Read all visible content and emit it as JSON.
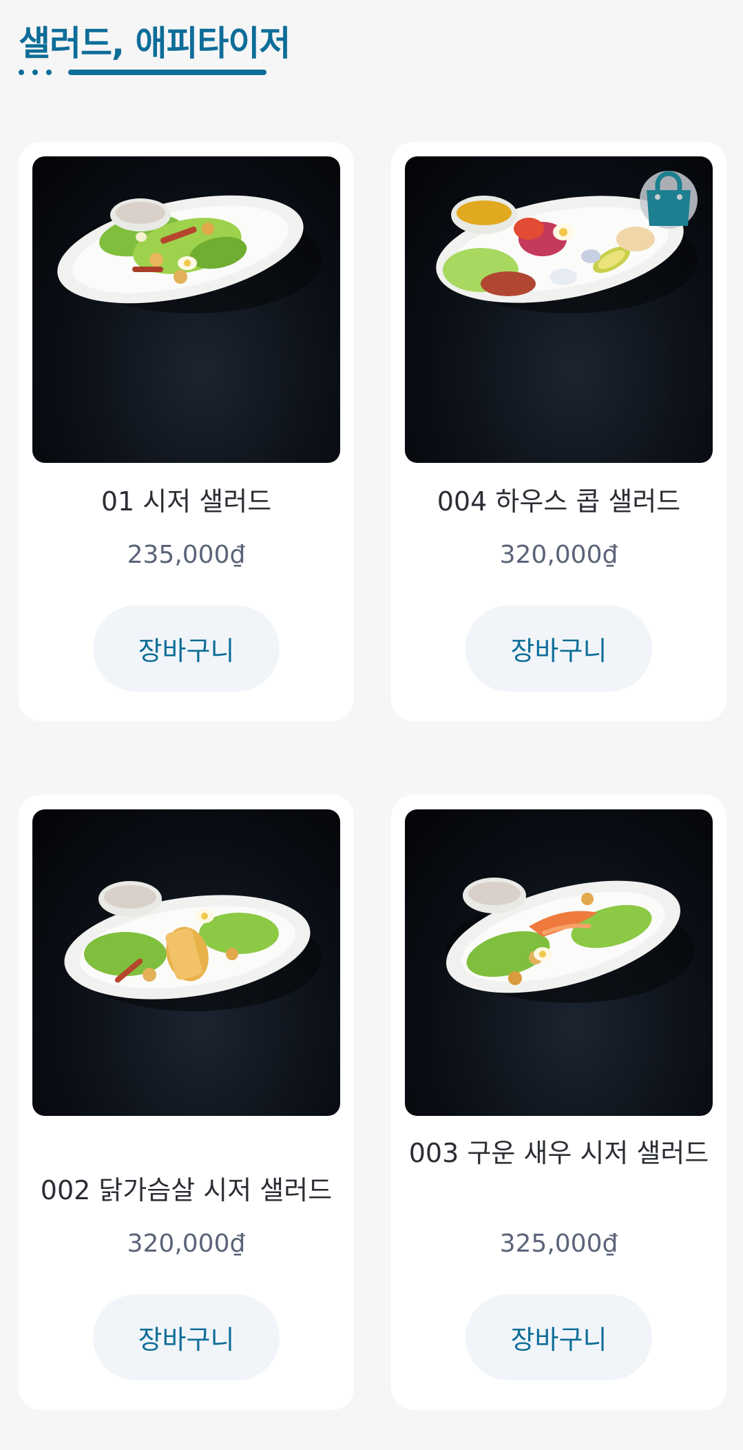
{
  "section": {
    "title": "샐러드, 애피타이저"
  },
  "colors": {
    "accent": "#0e6d98",
    "card_bg": "#ffffff",
    "page_bg": "#f6f6f6",
    "button_bg": "#f1f5f9",
    "price_text": "#5b6378"
  },
  "products": [
    {
      "name": "01 시저 샐러드",
      "price": "235,000₫",
      "cart_label": "장바구니",
      "image_alt": "caesar-salad-photo",
      "has_cart_badge": false,
      "badge_icon": ""
    },
    {
      "name": "004 하우스 콥 샐러드",
      "price": "320,000₫",
      "cart_label": "장바구니",
      "image_alt": "house-cobb-salad-photo",
      "has_cart_badge": true,
      "badge_icon": "shopping-bag-icon"
    },
    {
      "name": "002 닭가슴살 시저 샐러드",
      "price": "320,000₫",
      "cart_label": "장바구니",
      "image_alt": "chicken-breast-caesar-salad-photo",
      "has_cart_badge": false,
      "badge_icon": ""
    },
    {
      "name": "003 구운 새우 시저 샐러드",
      "price": "325,000₫",
      "cart_label": "장바구니",
      "image_alt": "grilled-shrimp-caesar-salad-photo",
      "has_cart_badge": false,
      "badge_icon": ""
    }
  ]
}
